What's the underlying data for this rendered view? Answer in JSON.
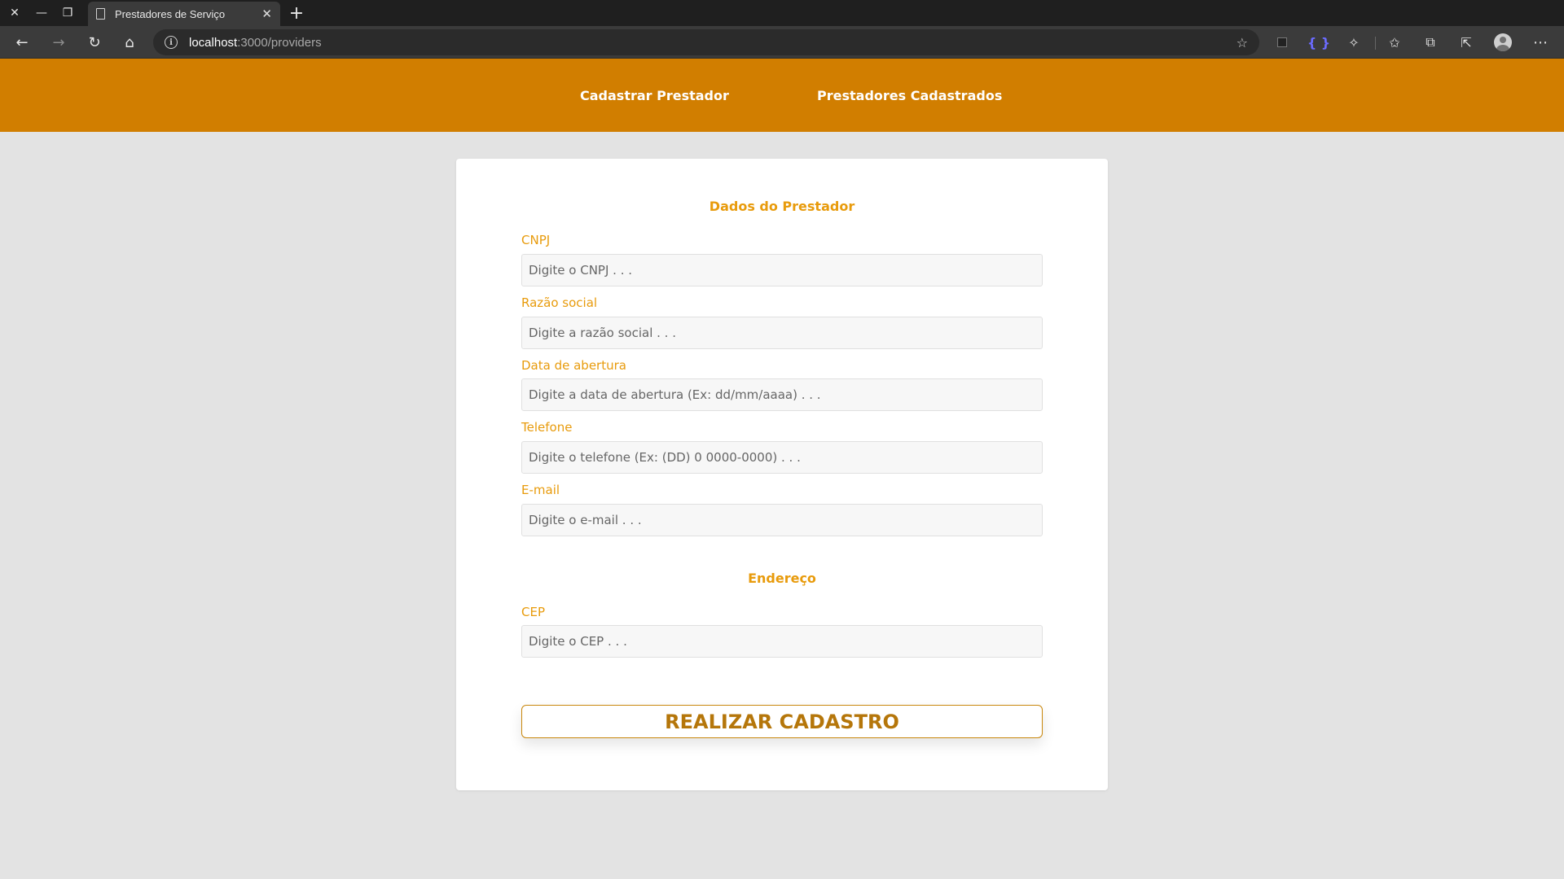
{
  "browser": {
    "tab_title": "Prestadores de Serviço",
    "url_host": "localhost",
    "url_path": ":3000/providers"
  },
  "site_nav": {
    "register_label": "Cadastrar Prestador",
    "list_label": "Prestadores Cadastrados"
  },
  "form": {
    "provider_section_title": "Dados do Prestador",
    "fields": [
      {
        "label": "CNPJ",
        "placeholder": "Digite o CNPJ . . ."
      },
      {
        "label": "Razão social",
        "placeholder": "Digite a razão social . . ."
      },
      {
        "label": "Data de abertura",
        "placeholder": "Digite a data de abertura (Ex: dd/mm/aaaa) . . ."
      },
      {
        "label": "Telefone",
        "placeholder": "Digite o telefone (Ex: (DD) 0 0000-0000) . . ."
      },
      {
        "label": "E-mail",
        "placeholder": "Digite o e-mail . . ."
      }
    ],
    "address_section_title": "Endereço",
    "address_fields": [
      {
        "label": "CEP",
        "placeholder": "Digite o CEP . . ."
      }
    ],
    "submit_label": "REALIZAR CADASTRO"
  },
  "colors": {
    "header_bg": "#d17e00",
    "label": "#e89b0c",
    "button_text": "#b5760a"
  }
}
